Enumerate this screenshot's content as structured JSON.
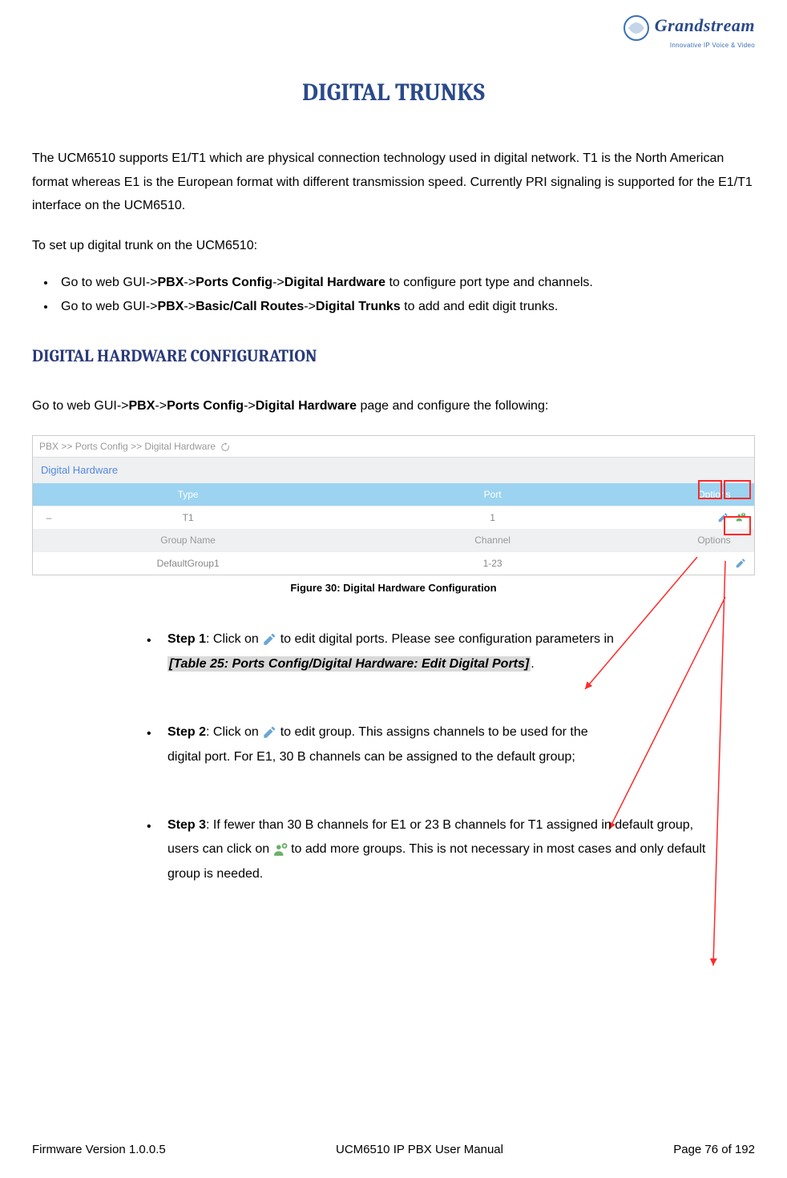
{
  "logo": {
    "brand": "Grandstream",
    "tagline": "Innovative IP Voice & Video"
  },
  "title": "DIGITAL TRUNKS",
  "intro": "The UCM6510 supports E1/T1 which are physical connection technology used in digital network. T1 is the North American format whereas E1 is the European format with different transmission speed. Currently PRI signaling is supported for the E1/T1 interface on the UCM6510.",
  "setup_intro": "To set up digital trunk on the UCM6510:",
  "setup_bullets": [
    {
      "pre": "Go to web GUI->",
      "b1": "PBX",
      "mid1": "->",
      "b2": "Ports Config",
      "mid2": "->",
      "b3": "Digital Hardware",
      "post": " to configure port type and channels."
    },
    {
      "pre": "Go to web GUI->",
      "b1": "PBX",
      "mid1": "->",
      "b2": "Basic/Call Routes",
      "mid2": "->",
      "b3": "Digital Trunks",
      "post": " to add and edit digit trunks."
    }
  ],
  "section_heading": "DIGITAL HARDWARE CONFIGURATION",
  "section_intro": {
    "pre": "Go to web GUI->",
    "b1": "PBX",
    "mid1": "->",
    "b2": "Ports Config",
    "mid2": "->",
    "b3": "Digital Hardware",
    "post": " page and configure the following:"
  },
  "screenshot": {
    "breadcrumb": "PBX >> Ports Config >> Digital Hardware",
    "section": "Digital Hardware",
    "headers": {
      "type": "Type",
      "port": "Port",
      "options": "Options"
    },
    "row1": {
      "type": "T1",
      "port": "1"
    },
    "subheaders": {
      "group": "Group Name",
      "channel": "Channel",
      "options": "Options"
    },
    "row2": {
      "group": "DefaultGroup1",
      "channel": "1-23"
    }
  },
  "caption": "Figure 30: Digital Hardware Configuration",
  "steps": {
    "s1": {
      "label": "Step 1",
      "pre": ": Click on ",
      "post": " to edit digital ports. Please see configuration parameters in",
      "ref": "[Table 25: Ports Config/Digital Hardware: Edit Digital Ports]",
      "refpost": "."
    },
    "s2": {
      "label": "Step 2",
      "pre": ": Click on ",
      "post": " to edit group. This assigns channels to be used for the",
      "line2": "digital port. For E1, 30 B channels can be assigned to the default group;"
    },
    "s3": {
      "label": "Step 3",
      "pre": ": If fewer than 30 B channels for E1 or 23 B channels for T1 assigned in default group, users can click on ",
      "post": " to add more groups. This is not necessary in most cases and only default group is needed."
    }
  },
  "footer": {
    "left": "Firmware Version 1.0.0.5",
    "center": "UCM6510 IP PBX User Manual",
    "right": "Page 76 of 192"
  }
}
